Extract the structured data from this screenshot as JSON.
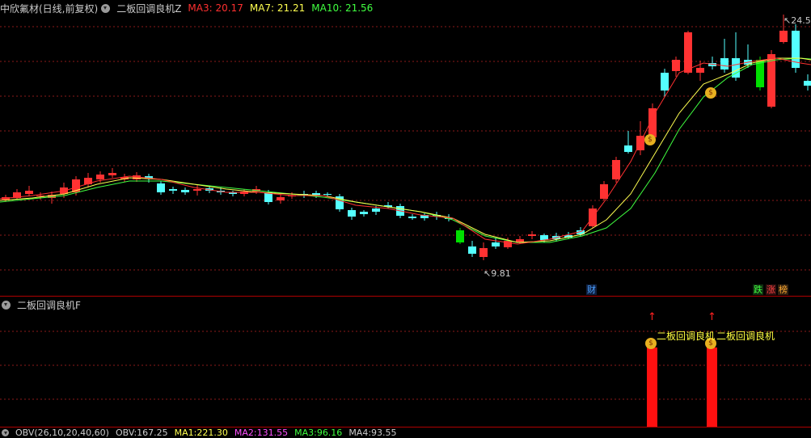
{
  "title_bar": {
    "stock_name": "中欣氟材(日线,前复权)",
    "indicator_name": "二板回调良机Z",
    "ma3": {
      "label": "MA3: 20.17",
      "color": "#ff3030"
    },
    "ma7": {
      "label": "MA7: 21.21",
      "color": "#ffff50"
    },
    "ma10": {
      "label": "MA10: 21.56",
      "color": "#40ff40"
    }
  },
  "sub_title_bar": {
    "indicator_name": "二板回调良机F"
  },
  "bottom_bar": {
    "items": [
      {
        "text": "OBV(26,10,20,40,60)",
        "color": "#cccccc"
      },
      {
        "text": "OBV:167.25",
        "color": "#cccccc"
      },
      {
        "text": "MA1:221.30",
        "color": "#ffff50"
      },
      {
        "text": "MA2:131.55",
        "color": "#ff50ff"
      },
      {
        "text": "MA3:96.16",
        "color": "#40ff40"
      },
      {
        "text": "MA4:93.55",
        "color": "#cccccc"
      }
    ]
  },
  "price_labels": {
    "high": "24.5",
    "low": "9.81"
  },
  "event_marks": {
    "cai": "财",
    "die": "跌",
    "zhang": "涨",
    "bang": "榜"
  },
  "signals": {
    "label": "二板回调良机"
  },
  "colors": {
    "up": "#ff3232",
    "down": "#54ffff",
    "limit_down": "#00e000",
    "divider": "#b00000",
    "grid": "#8b1a1a"
  }
}
